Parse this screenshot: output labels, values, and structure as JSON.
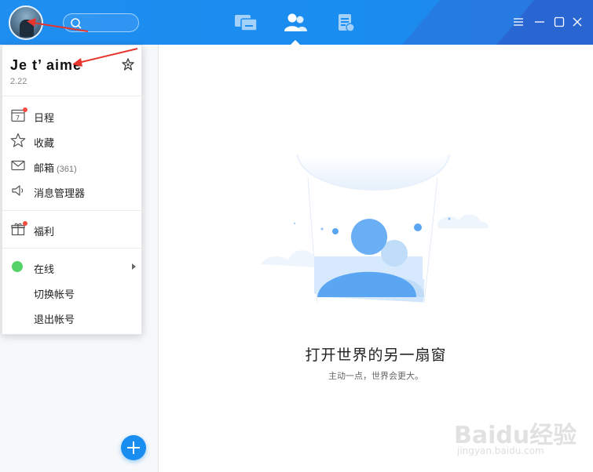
{
  "header": {
    "search": {
      "placeholder": ""
    },
    "tabs": [
      {
        "name": "messages",
        "icon": "chat-icon"
      },
      {
        "name": "contacts",
        "icon": "contacts-icon",
        "active": true
      },
      {
        "name": "space",
        "icon": "document-icon"
      }
    ],
    "window_controls": [
      "menu-icon",
      "minimize-icon",
      "maximize-icon",
      "close-icon"
    ],
    "accent_color": "#1a8df0"
  },
  "profile": {
    "name": "Je t’ aime",
    "level": "2.22",
    "menu_group_1": [
      {
        "label": "日程",
        "icon": "calendar-icon",
        "badge": true
      },
      {
        "label": "收藏",
        "icon": "star-icon"
      },
      {
        "label": "邮箱",
        "count": "(361)",
        "icon": "mail-icon"
      },
      {
        "label": "消息管理器",
        "icon": "speaker-icon"
      }
    ],
    "menu_group_2": [
      {
        "label": "福利",
        "icon": "gift-icon",
        "badge": true
      }
    ],
    "menu_group_3": [
      {
        "label": "在线",
        "icon": "online-status-dot",
        "status_color": "#55d36a"
      },
      {
        "label": "切换帐号"
      },
      {
        "label": "退出帐号"
      }
    ]
  },
  "main": {
    "empty_title": "打开世界的另一扇窗",
    "empty_subtitle": "主动一点，世界会更大。"
  },
  "watermark": {
    "brand": "Baidu经验",
    "site": "jingyan.baidu.com"
  }
}
